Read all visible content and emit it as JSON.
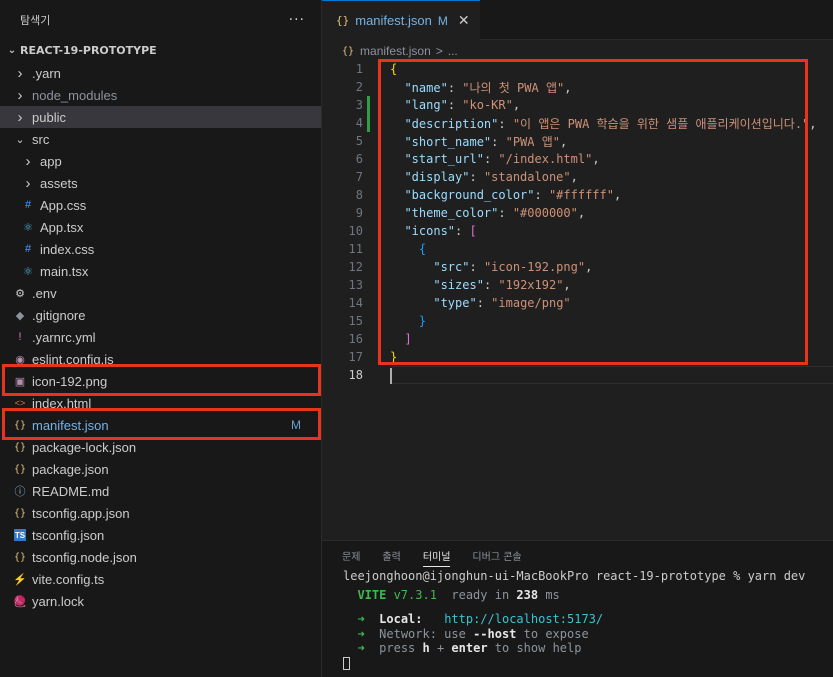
{
  "sidebar": {
    "title": "탐색기",
    "more": "···",
    "project": "REACT-19-PROTOTYPE",
    "items": [
      {
        "label": ".yarn",
        "icon": "chevron-right-icon",
        "glyph": "›"
      },
      {
        "label": "node_modules",
        "icon": "chevron-right-icon",
        "glyph": "›"
      },
      {
        "label": "public",
        "icon": "chevron-right-icon",
        "glyph": "›"
      },
      {
        "label": "src",
        "icon": "chevron-down-icon",
        "glyph": "⌄"
      },
      {
        "label": "app",
        "icon": "chevron-right-icon",
        "glyph": "›"
      },
      {
        "label": "assets",
        "icon": "chevron-right-icon",
        "glyph": "›"
      },
      {
        "label": "App.css",
        "icon": "css-file-icon",
        "glyph": "#"
      },
      {
        "label": "App.tsx",
        "icon": "react-file-icon",
        "glyph": "⚛"
      },
      {
        "label": "index.css",
        "icon": "css-file-icon",
        "glyph": "#"
      },
      {
        "label": "main.tsx",
        "icon": "react-file-icon",
        "glyph": "⚛"
      },
      {
        "label": ".env",
        "icon": "gear-icon",
        "glyph": "⚙"
      },
      {
        "label": ".gitignore",
        "icon": "git-icon",
        "glyph": "◆"
      },
      {
        "label": ".yarnrc.yml",
        "icon": "exclamation-icon",
        "glyph": "!"
      },
      {
        "label": "eslint.config.js",
        "icon": "eslint-icon",
        "glyph": "◉"
      },
      {
        "label": "icon-192.png",
        "icon": "image-file-icon",
        "glyph": "▣"
      },
      {
        "label": "index.html",
        "icon": "html-file-icon",
        "glyph": "<>"
      },
      {
        "label": "manifest.json",
        "icon": "json-file-icon",
        "glyph": "{}",
        "badge": "M"
      },
      {
        "label": "package-lock.json",
        "icon": "json-file-icon",
        "glyph": "{}"
      },
      {
        "label": "package.json",
        "icon": "json-file-icon",
        "glyph": "{}"
      },
      {
        "label": "README.md",
        "icon": "info-icon",
        "glyph": "ⓘ"
      },
      {
        "label": "tsconfig.app.json",
        "icon": "json-file-icon",
        "glyph": "{}"
      },
      {
        "label": "tsconfig.json",
        "icon": "typescript-file-icon",
        "glyph": "TS"
      },
      {
        "label": "tsconfig.node.json",
        "icon": "json-file-icon",
        "glyph": "{}"
      },
      {
        "label": "vite.config.ts",
        "icon": "vite-icon",
        "glyph": "⚡"
      },
      {
        "label": "yarn.lock",
        "icon": "yarn-icon",
        "glyph": "🧶"
      }
    ]
  },
  "editor": {
    "tab": {
      "icon_glyph": "{}",
      "name": "manifest.json",
      "modified": "M",
      "close": "✕"
    },
    "breadcrumb": {
      "file": "manifest.json",
      "sep": ">",
      "more": "..."
    },
    "lines": [
      {
        "n": "1",
        "parts": [
          [
            "br1",
            "{"
          ]
        ]
      },
      {
        "n": "2",
        "parts": [
          [
            "p",
            "  "
          ],
          [
            "k",
            "\"name\""
          ],
          [
            "p",
            ": "
          ],
          [
            "s",
            "\"나의 첫 PWA 앱\""
          ],
          [
            "p",
            ","
          ]
        ]
      },
      {
        "n": "3",
        "parts": [
          [
            "p",
            "  "
          ],
          [
            "k",
            "\"lang\""
          ],
          [
            "p",
            ": "
          ],
          [
            "s",
            "\"ko-KR\""
          ],
          [
            "p",
            ","
          ]
        ],
        "changed": true
      },
      {
        "n": "4",
        "parts": [
          [
            "p",
            "  "
          ],
          [
            "k",
            "\"description\""
          ],
          [
            "p",
            ": "
          ],
          [
            "s",
            "\"이 앱은 PWA 학습을 위한 샘플 애플리케이션입니다.\""
          ],
          [
            "p",
            ","
          ]
        ],
        "changed": true
      },
      {
        "n": "5",
        "parts": [
          [
            "p",
            "  "
          ],
          [
            "k",
            "\"short_name\""
          ],
          [
            "p",
            ": "
          ],
          [
            "s",
            "\"PWA 앱\""
          ],
          [
            "p",
            ","
          ]
        ]
      },
      {
        "n": "6",
        "parts": [
          [
            "p",
            "  "
          ],
          [
            "k",
            "\"start_url\""
          ],
          [
            "p",
            ": "
          ],
          [
            "s",
            "\"/index.html\""
          ],
          [
            "p",
            ","
          ]
        ]
      },
      {
        "n": "7",
        "parts": [
          [
            "p",
            "  "
          ],
          [
            "k",
            "\"display\""
          ],
          [
            "p",
            ": "
          ],
          [
            "s",
            "\"standalone\""
          ],
          [
            "p",
            ","
          ]
        ]
      },
      {
        "n": "8",
        "parts": [
          [
            "p",
            "  "
          ],
          [
            "k",
            "\"background_color\""
          ],
          [
            "p",
            ": "
          ],
          [
            "s",
            "\"#ffffff\""
          ],
          [
            "p",
            ","
          ]
        ]
      },
      {
        "n": "9",
        "parts": [
          [
            "p",
            "  "
          ],
          [
            "k",
            "\"theme_color\""
          ],
          [
            "p",
            ": "
          ],
          [
            "s",
            "\"#000000\""
          ],
          [
            "p",
            ","
          ]
        ]
      },
      {
        "n": "10",
        "parts": [
          [
            "p",
            "  "
          ],
          [
            "k",
            "\"icons\""
          ],
          [
            "p",
            ": "
          ],
          [
            "br2",
            "["
          ]
        ]
      },
      {
        "n": "11",
        "parts": [
          [
            "p",
            "    "
          ],
          [
            "br3",
            "{"
          ]
        ]
      },
      {
        "n": "12",
        "parts": [
          [
            "p",
            "      "
          ],
          [
            "k",
            "\"src\""
          ],
          [
            "p",
            ": "
          ],
          [
            "s",
            "\"icon-192.png\""
          ],
          [
            "p",
            ","
          ]
        ]
      },
      {
        "n": "13",
        "parts": [
          [
            "p",
            "      "
          ],
          [
            "k",
            "\"sizes\""
          ],
          [
            "p",
            ": "
          ],
          [
            "s",
            "\"192x192\""
          ],
          [
            "p",
            ","
          ]
        ]
      },
      {
        "n": "14",
        "parts": [
          [
            "p",
            "      "
          ],
          [
            "k",
            "\"type\""
          ],
          [
            "p",
            ": "
          ],
          [
            "s",
            "\"image/png\""
          ]
        ]
      },
      {
        "n": "15",
        "parts": [
          [
            "p",
            "    "
          ],
          [
            "br3",
            "}"
          ]
        ]
      },
      {
        "n": "16",
        "parts": [
          [
            "p",
            "  "
          ],
          [
            "br2",
            "]"
          ]
        ]
      },
      {
        "n": "17",
        "parts": [
          [
            "br1",
            "}"
          ]
        ]
      },
      {
        "n": "18",
        "parts": [],
        "current": true
      }
    ]
  },
  "panel": {
    "tabs": [
      "문제",
      "출력",
      "터미널",
      "디버그 콘솔"
    ],
    "active_tab": "터미널",
    "terminal": {
      "prompt": "leejonghoon@ijonghun-ui-MacBookPro react-19-prototype % yarn dev",
      "vite_name": "VITE",
      "vite_version": " v7.3.1",
      "ready_text": "  ready in ",
      "ready_ms": "238",
      "ready_unit": " ms",
      "arrow": "➜",
      "local_label": "Local:",
      "local_url": "http://localhost:5173/",
      "network_label": "Network:",
      "network_text": " use ",
      "network_flag": "--host",
      "network_tail": " to expose",
      "help_pre": "press ",
      "help_h": "h",
      "help_plus": " + ",
      "help_enter": "enter",
      "help_tail": " to show help"
    }
  },
  "colors": {
    "highlight": "#e8341c",
    "accent": "#0078d4",
    "modified": "#73b3e6"
  }
}
